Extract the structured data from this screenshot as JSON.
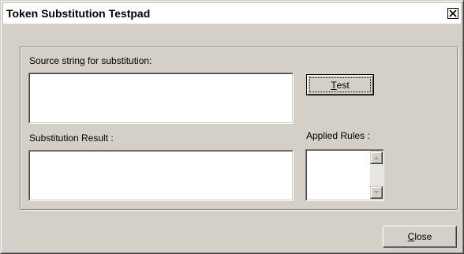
{
  "window": {
    "title": "Token Substitution Testpad"
  },
  "icons": {
    "close": "close-icon",
    "scroll_up": "arrow-up-icon",
    "scroll_down": "arrow-down-icon"
  },
  "source": {
    "label": "Source string for substitution:",
    "value": ""
  },
  "test_button": {
    "mnemonic": "T",
    "rest": "est"
  },
  "result": {
    "label": "Substitution Result :",
    "value": ""
  },
  "rules": {
    "label": "Applied Rules :",
    "items": []
  },
  "close_button": {
    "mnemonic": "C",
    "rest": "lose"
  },
  "colors": {
    "dialog_face": "#d4d0c8",
    "field_background": "#ffffff",
    "titlebar_background": "#ffffff"
  }
}
